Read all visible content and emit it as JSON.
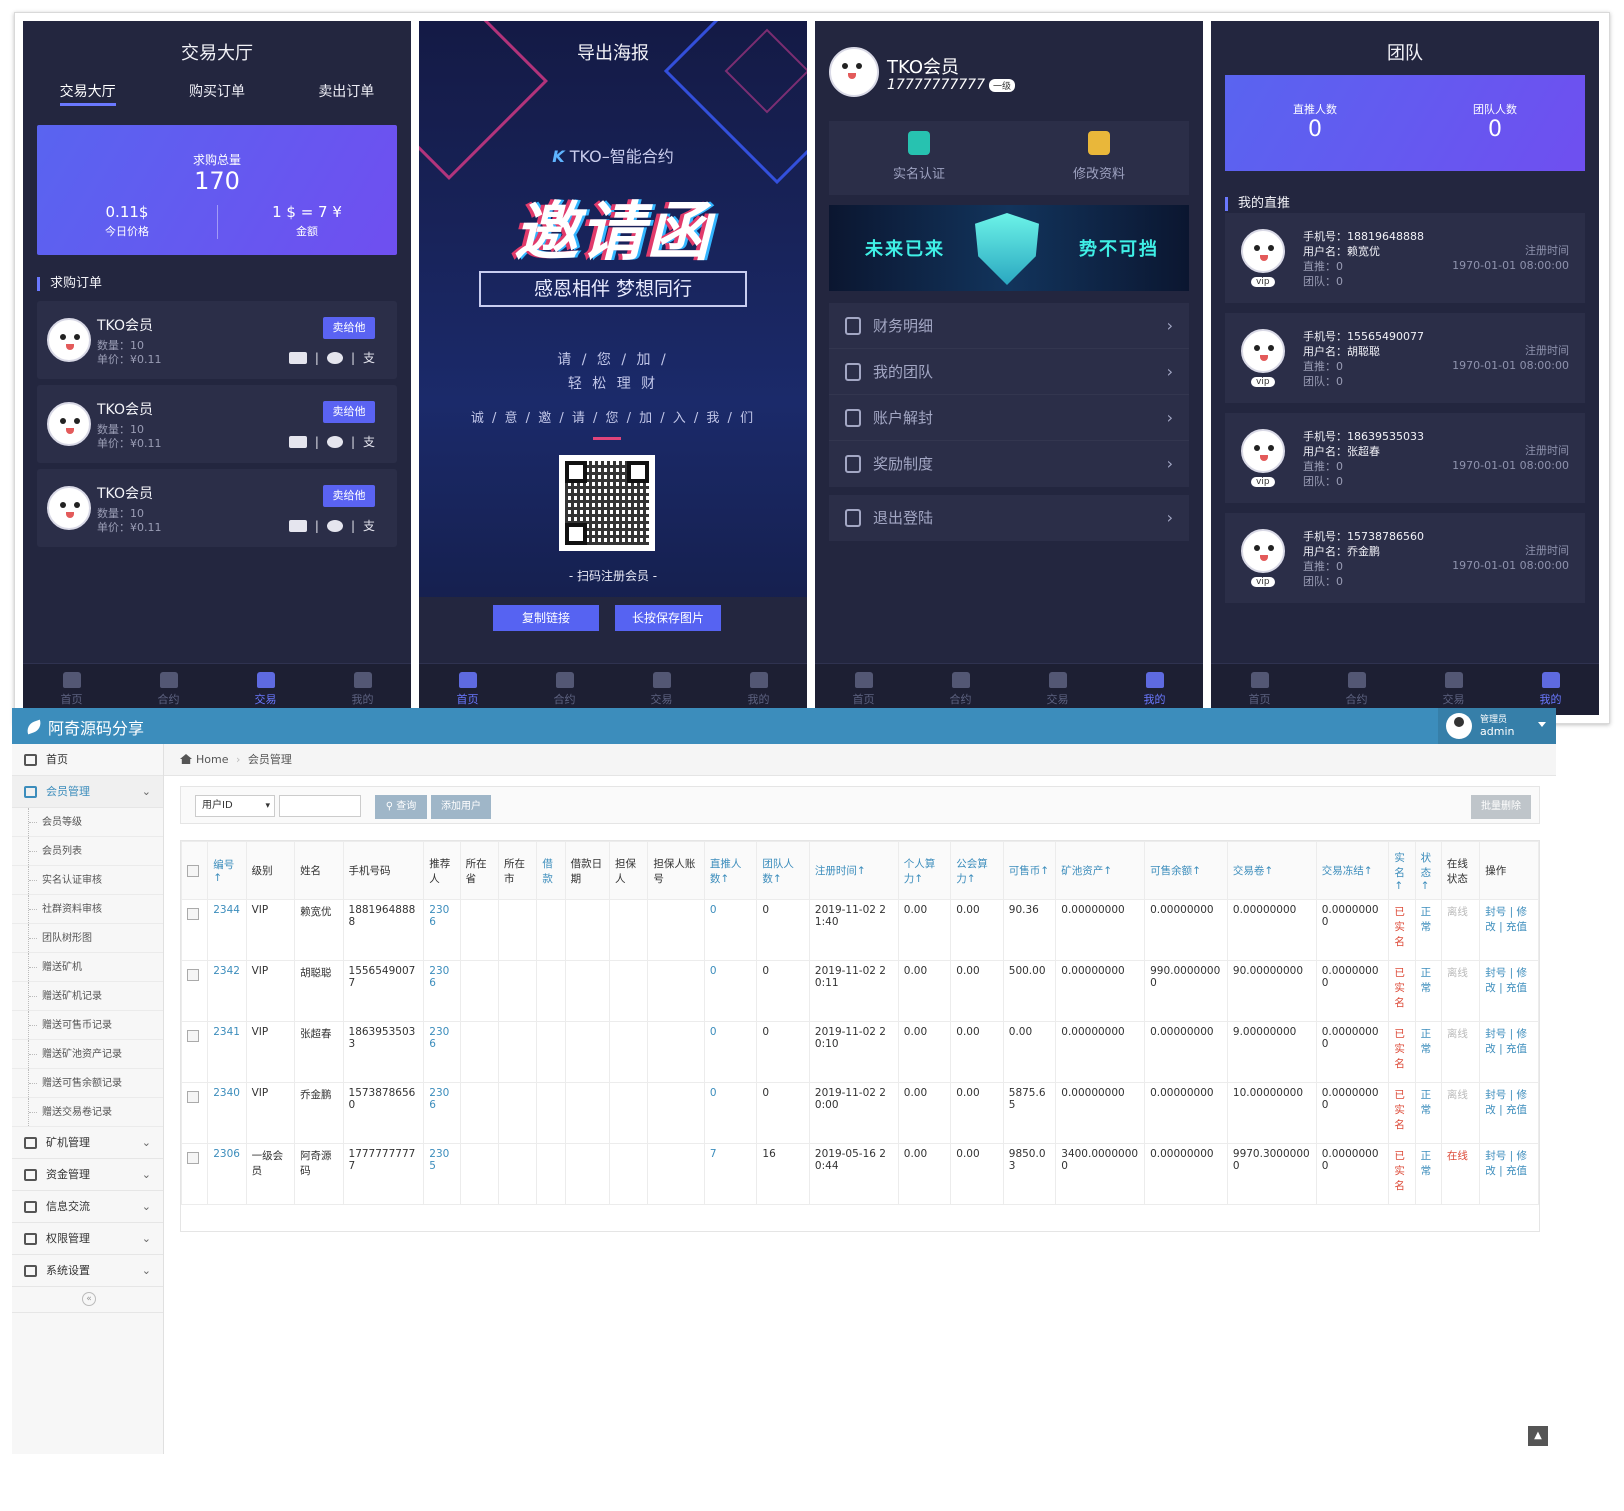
{
  "phone1": {
    "title": "交易大厅",
    "tabs": [
      "交易大厅",
      "购买订单",
      "卖出订单"
    ],
    "summary": {
      "label": "求购总量",
      "total": "170",
      "price_value": "0.11$",
      "price_label": "今日价格",
      "rate_value": "1 $ = 7 ¥",
      "rate_label": "金额"
    },
    "section": "求购订单",
    "orders": [
      {
        "name": "TKO会员",
        "line1": "数量：10",
        "line2": "单价：¥0.11",
        "button": "卖给他"
      },
      {
        "name": "TKO会员",
        "line1": "数量：10",
        "line2": "单价：¥0.11",
        "button": "卖给他"
      },
      {
        "name": "TKO会员",
        "line1": "数量：10",
        "line2": "单价：¥0.11",
        "button": "卖给他"
      }
    ]
  },
  "phone2": {
    "title": "导出海报",
    "brand": "TKO–智能合约",
    "brand_mark": "K",
    "headline": "邀请函",
    "ribbon": "感恩相伴  梦想同行",
    "line1": "请 / 您 / 加 /",
    "line2": "轻 松 理 财",
    "line3": "诚 / 意 / 邀 / 请 / 您 / 加 / 入 / 我 / 们",
    "scan_label": "- 扫码注册会员 -",
    "copy_button": "复制链接",
    "save_button": "长按保存图片"
  },
  "phone3": {
    "name": "TKO会员",
    "phone": "17777777777",
    "level": "一级",
    "actions": [
      "实名认证",
      "修改资料"
    ],
    "hero_left": "未来已来",
    "hero_right": "势不可挡",
    "menu": [
      "财务明细",
      "我的团队",
      "账户解封",
      "奖励制度"
    ],
    "logout": "退出登陆"
  },
  "phone4": {
    "title": "团队",
    "direct_label": "直推人数",
    "direct_value": "0",
    "team_label": "团队人数",
    "team_value": "0",
    "section": "我的直推",
    "members": [
      {
        "phone": "手机号：18819648888",
        "user": "用户名：赖宽优",
        "direct": "直推：0",
        "team": "团队：0",
        "reg_label": "注册时间",
        "reg_time": "1970-01-01 08:00:00"
      },
      {
        "phone": "手机号：15565490077",
        "user": "用户名：胡聪聪",
        "direct": "直推：0",
        "team": "团队：0",
        "reg_label": "注册时间",
        "reg_time": "1970-01-01 08:00:00"
      },
      {
        "phone": "手机号：18639535033",
        "user": "用户名：张超春",
        "direct": "直推：0",
        "team": "团队：0",
        "reg_label": "注册时间",
        "reg_time": "1970-01-01 08:00:00"
      },
      {
        "phone": "手机号：15738786560",
        "user": "用户名：乔金鹏",
        "direct": "直推：0",
        "team": "团队：0",
        "reg_label": "注册时间",
        "reg_time": "1970-01-01 08:00:00"
      }
    ],
    "vip": "vip"
  },
  "bottom_nav": [
    "首页",
    "合约",
    "交易",
    "我的"
  ],
  "admin": {
    "brand": "阿奇源码分享",
    "user_role": "管理员",
    "user_name": "admin",
    "breadcrumb_home": "Home",
    "breadcrumb_current": "会员管理",
    "sidebar": {
      "home": "首页",
      "member_mgmt": "会员管理",
      "member_sub": [
        "会员等级",
        "会员列表",
        "实名认证审核",
        "社群资料审核",
        "团队树形图",
        "赠送矿机",
        "赠送矿机记录",
        "赠送可售币记录",
        "赠送矿池资产记录",
        "赠送可售余额记录",
        "赠送交易卷记录"
      ],
      "groups": [
        "矿机管理",
        "资金管理",
        "信息交流",
        "权限管理",
        "系统设置"
      ]
    },
    "toolbar": {
      "select_value": "用户ID",
      "search_button": "查询",
      "add_button": "添加用户",
      "batch_delete": "批量删除"
    },
    "columns": [
      "编号↑",
      "级别",
      "姓名",
      "手机号码",
      "推荐人",
      "所在省",
      "所在市",
      "借款",
      "借款日期",
      "担保人",
      "担保人账号",
      "直推人数↑",
      "团队人数↑",
      "注册时间↑",
      "个人算力↑",
      "公会算力↑",
      "可售币↑",
      "矿池资产↑",
      "可售余额↑",
      "交易卷↑",
      "交易冻结↑",
      "实名↑",
      "状态↑",
      "在线状态",
      "操作"
    ],
    "rows": [
      {
        "id": "2344",
        "level": "VIP",
        "name": "赖宽优",
        "phone": "18819648888",
        "ref": "2306",
        "direct": "0",
        "team": "0",
        "reg": "2019-11-02 21:40",
        "p_power": "0.00",
        "g_power": "0.00",
        "coin": "90.36",
        "pool": "0.00000000",
        "balance": "0.00000000",
        "vol": "0.00000000",
        "frozen": "0.00000000",
        "real": "已实名",
        "status": "正常",
        "online": "离线",
        "ops": "封号 | 修改 | 充值"
      },
      {
        "id": "2342",
        "level": "VIP",
        "name": "胡聪聪",
        "phone": "15565490077",
        "ref": "2306",
        "direct": "0",
        "team": "0",
        "reg": "2019-11-02 20:11",
        "p_power": "0.00",
        "g_power": "0.00",
        "coin": "500.00",
        "pool": "0.00000000",
        "balance": "990.00000000",
        "vol": "90.00000000",
        "frozen": "0.00000000",
        "real": "已实名",
        "status": "正常",
        "online": "离线",
        "ops": "封号 | 修改 | 充值"
      },
      {
        "id": "2341",
        "level": "VIP",
        "name": "张超春",
        "phone": "18639535033",
        "ref": "2306",
        "direct": "0",
        "team": "0",
        "reg": "2019-11-02 20:10",
        "p_power": "0.00",
        "g_power": "0.00",
        "coin": "0.00",
        "pool": "0.00000000",
        "balance": "0.00000000",
        "vol": "9.00000000",
        "frozen": "0.00000000",
        "real": "已实名",
        "status": "正常",
        "online": "离线",
        "ops": "封号 | 修改 | 充值"
      },
      {
        "id": "2340",
        "level": "VIP",
        "name": "乔金鹏",
        "phone": "15738786560",
        "ref": "2306",
        "direct": "0",
        "team": "0",
        "reg": "2019-11-02 20:00",
        "p_power": "0.00",
        "g_power": "0.00",
        "coin": "5875.65",
        "pool": "0.00000000",
        "balance": "0.00000000",
        "vol": "10.00000000",
        "frozen": "0.00000000",
        "real": "已实名",
        "status": "正常",
        "online": "离线",
        "ops": "封号 | 修改 | 充值"
      },
      {
        "id": "2306",
        "level": "一级会员",
        "name": "阿奇源码",
        "phone": "17777777777",
        "ref": "2305",
        "direct": "7",
        "team": "16",
        "reg": "2019-05-16 20:44",
        "p_power": "0.00",
        "g_power": "0.00",
        "coin": "9850.03",
        "pool": "3400.00000000",
        "balance": "0.00000000",
        "vol": "9970.30000000",
        "frozen": "0.00000000",
        "real": "已实名",
        "status": "正常",
        "online": "在线",
        "ops": "封号 | 修改 | 充值"
      }
    ]
  },
  "colors": {
    "accent": "#5a63f2",
    "phone_bg": "#23263f",
    "admin_header": "#3c8dbc",
    "danger": "#dd4b39"
  }
}
